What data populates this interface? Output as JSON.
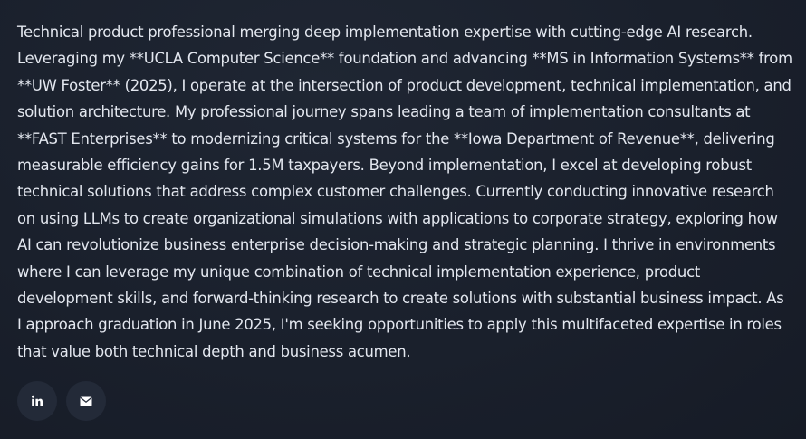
{
  "about": {
    "bio": "Technical product professional merging deep implementation expertise with cutting-edge AI research. Leveraging my **UCLA Computer Science** foundation and advancing **MS in Information Systems** from **UW Foster** (2025), I operate at the intersection of product development, technical implementation, and solution architecture. My professional journey spans leading a team of implementation consultants at **FAST Enterprises** to modernizing critical systems for the **Iowa Department of Revenue**, delivering measurable efficiency gains for 1.5M taxpayers. Beyond implementation, I excel at developing robust technical solutions that address complex customer challenges. Currently conducting innovative research on using LLMs to create organizational simulations with applications to corporate strategy, exploring how AI can revolutionize business enterprise decision-making and strategic planning. I thrive in environments where I can leverage my unique combination of technical implementation experience, product development skills, and forward-thinking research to create solutions with substantial business impact. As I approach graduation in June 2025, I'm seeking opportunities to apply this multifaceted expertise in roles that value both technical depth and business acumen."
  },
  "social": {
    "links": [
      {
        "icon": "linkedin-icon"
      },
      {
        "icon": "envelope-icon"
      }
    ]
  },
  "colors": {
    "background": "#1a202c",
    "text": "#e3e7ef",
    "button_bg": "#232a38",
    "icon": "#ffffff"
  }
}
